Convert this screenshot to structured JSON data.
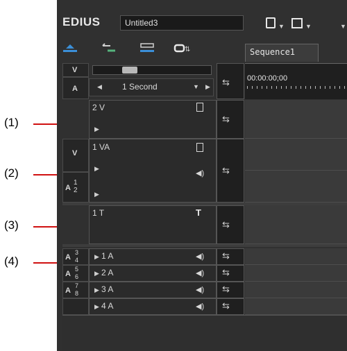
{
  "callouts": [
    "(1)",
    "(2)",
    "(3)",
    "(4)"
  ],
  "app": {
    "name": "EDIUS",
    "project": "Untitled3"
  },
  "sequence_tab": "Sequence1",
  "timeline": {
    "timecode": "00:00:00;00",
    "scale": "1 Second"
  },
  "toolbar_icons": [
    "new-project-icon",
    "save-icon"
  ],
  "tracks": [
    {
      "name": "2 V"
    },
    {
      "name": "1 VA"
    },
    {
      "name": "1 T"
    },
    {
      "name": "1 A"
    },
    {
      "name": "2 A"
    },
    {
      "name": "3 A"
    },
    {
      "name": "4 A"
    }
  ],
  "patch_labels": {
    "v": "V",
    "a": "A",
    "a12": "1",
    "a12b": "2",
    "a34": "3",
    "a34b": "4",
    "a56": "5",
    "a56b": "6",
    "a78": "7",
    "a78b": "8"
  },
  "colors": {
    "panel": "#303030",
    "callout_line": "#d01010",
    "tab": "#3c3c3c"
  }
}
